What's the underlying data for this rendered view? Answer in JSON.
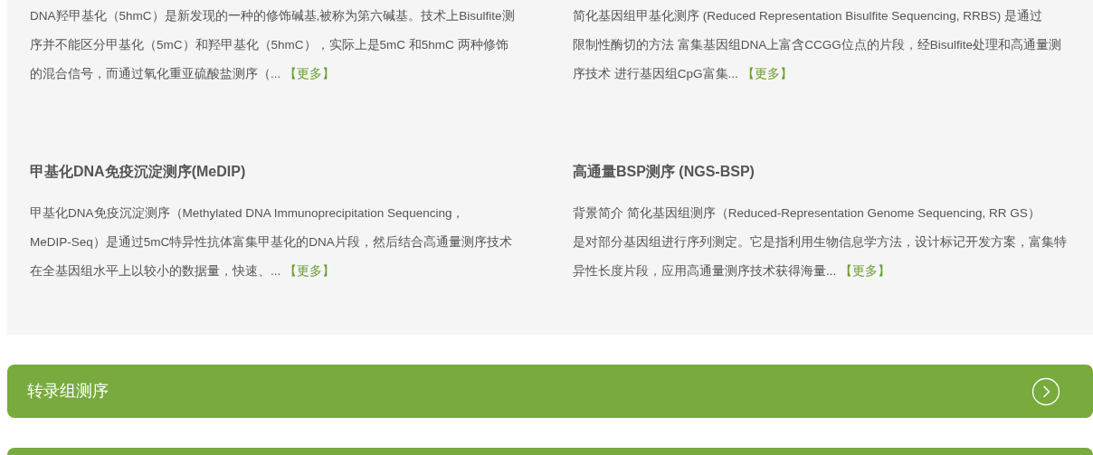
{
  "cards": [
    {
      "description": [
        "DNA羟甲基化（5hmC）是新发现的一种的修饰碱基,被称为第六碱基。技术上Bisulfite测",
        "序并不能区分甲基化（5mC）和羟甲基化（5hmC），实际上是5mC 和5hmC 两种修饰",
        "的混合信号，而通过氧化重亚硫酸盐测序（..."
      ],
      "more": "【更多】"
    },
    {
      "description": [
        "简化基因组甲基化测序 (Reduced Representation Bisulfite Sequencing, RRBS) 是通过",
        "限制性酶切的方法 富集基因组DNA上富含CCGG位点的片段，经Bisulfite处理和高通量测",
        "序技术 进行基因组CpG富集..."
      ],
      "more": "【更多】"
    },
    {
      "title": "甲基化DNA免疫沉淀测序(MeDIP)",
      "description": [
        "甲基化DNA免疫沉淀测序（Methylated DNA Immunoprecipitation Sequencing，",
        "MeDIP-Seq）是通过5mC特异性抗体富集甲基化的DNA片段，然后结合高通量测序技术",
        "在全基因组水平上以较小的数据量，快速、..."
      ],
      "more": "【更多】"
    },
    {
      "title": "高通量BSP测序 (NGS-BSP)",
      "description": [
        "背景简介 简化基因组测序（Reduced-Representation Genome Sequencing, RR GS）",
        "是对部分基因组进行序列测定。它是指利用生物信息学方法，设计标记开发方案，富集特",
        "异性长度片段，应用高通量测序技术获得海量..."
      ],
      "more": "【更多】"
    }
  ],
  "sections": [
    {
      "title": "转录组测序"
    }
  ]
}
